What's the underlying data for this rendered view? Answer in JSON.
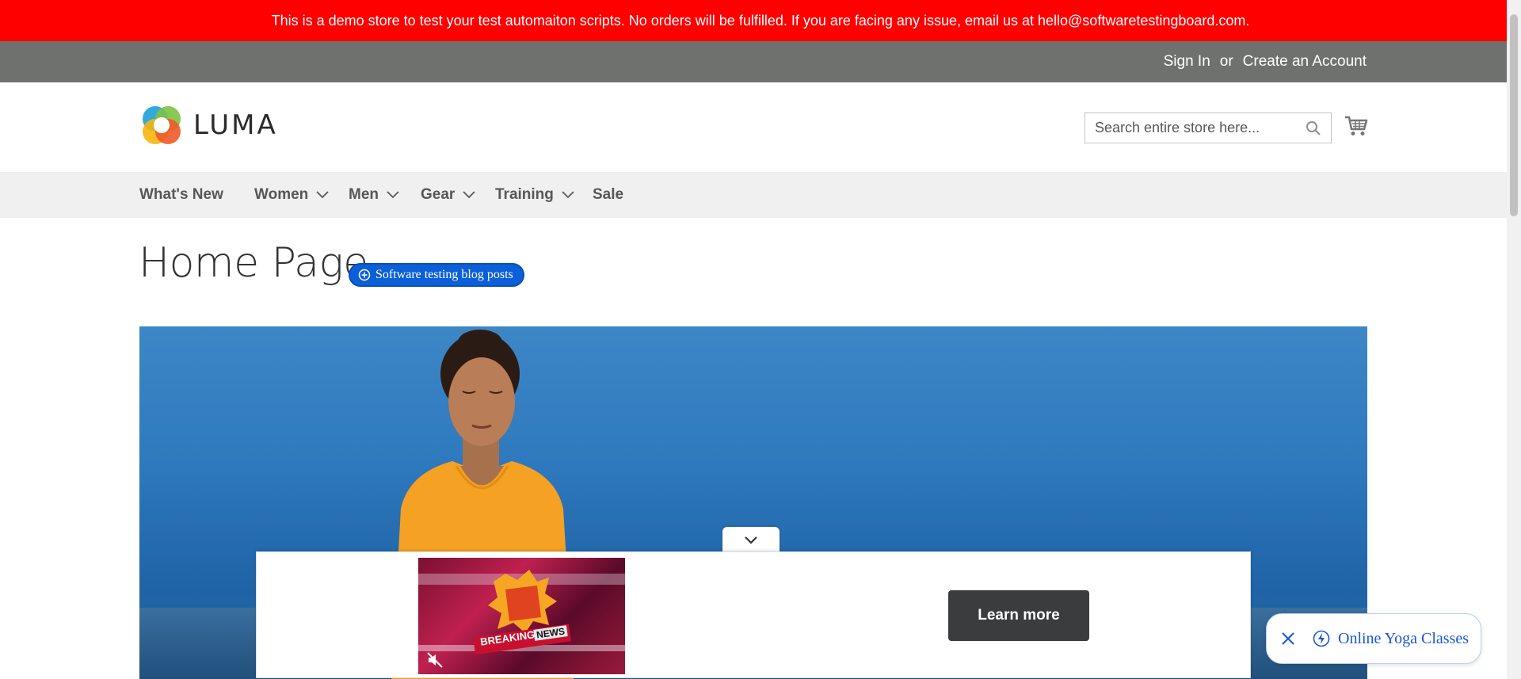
{
  "demo_notice": "This is a demo store to test your test automaiton scripts. No orders will be fulfilled. If you are facing any issue, email us at hello@softwaretestingboard.com.",
  "header": {
    "sign_in": "Sign In",
    "or": "or",
    "create_account": "Create an Account"
  },
  "logo": {
    "text": "LUMA"
  },
  "search": {
    "placeholder": "Search entire store here..."
  },
  "nav": {
    "items": [
      {
        "label": "What's New"
      },
      {
        "label": "Women"
      },
      {
        "label": "Men"
      },
      {
        "label": "Gear"
      },
      {
        "label": "Training"
      },
      {
        "label": "Sale"
      }
    ]
  },
  "page": {
    "title": "Home Page",
    "blog_pill": "Software testing blog posts"
  },
  "ad": {
    "thumb_badge_1": "BREAKING",
    "thumb_badge_2": "NEWS",
    "learn_more": "Learn more"
  },
  "yoga_pill": {
    "label": "Online Yoga Classes"
  },
  "colors": {
    "demo_bar": "#ff0000",
    "header_top": "#6e716e",
    "nav_bg": "#f0f0f0",
    "blog_pill": "#0b5fd9",
    "learn_more_bg": "#3b3c3d",
    "yoga_link": "#1a56d6"
  }
}
